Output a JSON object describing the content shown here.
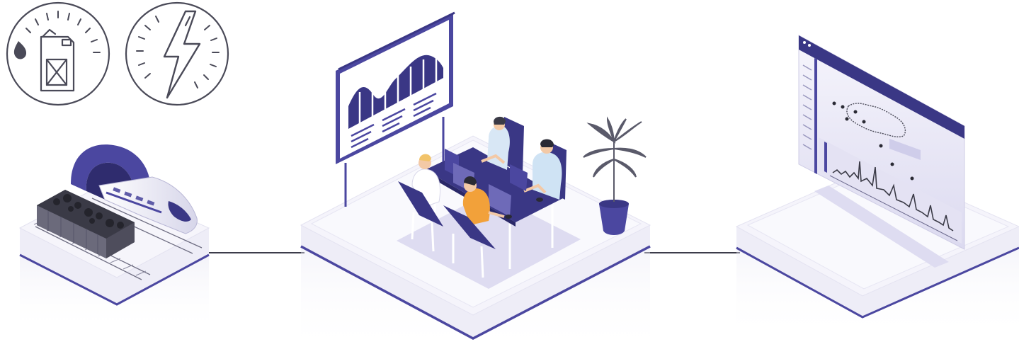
{
  "colors": {
    "accent": "#4b47a0",
    "accent_dark": "#3a3785",
    "accent_light": "#8d89cf",
    "platform_top": "#f4f3fb",
    "platform_side": "#e7e6f4",
    "platform_edge": "#4b47a0",
    "line_gray": "#3c3c4a",
    "icon_stroke": "#4a4a58",
    "skin": "#f3c9a6",
    "shirt_orange": "#f2a13a",
    "shirt_blue": "#cfe3f4",
    "plant_leaf": "#5a5a6a",
    "pot": "#4b47a0"
  },
  "icons": {
    "fuel": "fuel-gauge-icon",
    "electric": "electric-gauge-icon"
  },
  "scenes": {
    "left": "train-and-coal-wagon",
    "center": "team-meeting-with-presentation",
    "right": "monitoring-dashboard-with-map"
  }
}
